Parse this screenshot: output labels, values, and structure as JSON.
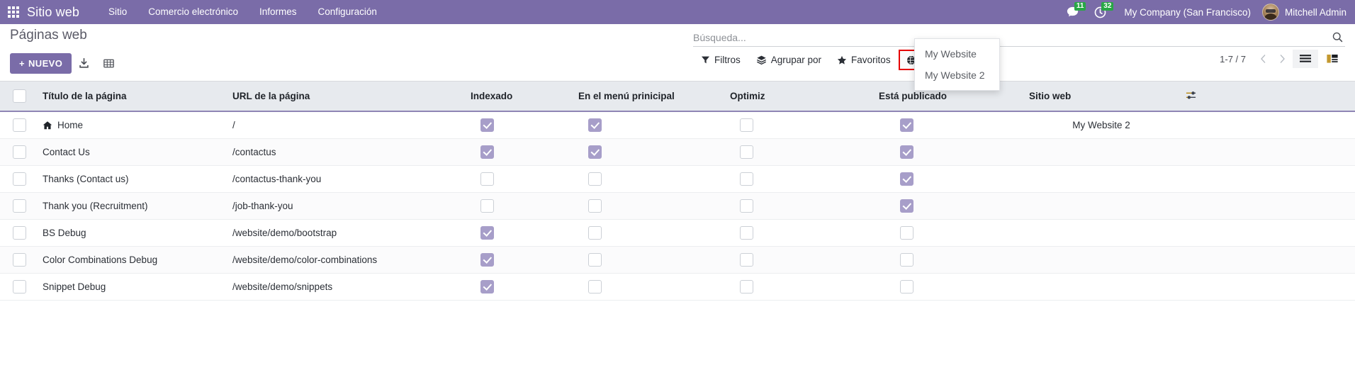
{
  "navbar": {
    "apps_icon": "apps-grid-icon",
    "brand": "Sitio web",
    "menu": [
      {
        "label": "Sitio"
      },
      {
        "label": "Comercio electrónico"
      },
      {
        "label": "Informes"
      },
      {
        "label": "Configuración"
      }
    ],
    "messages_icon": "chat-bubble-icon",
    "messages_count": "11",
    "activities_icon": "clock-icon",
    "activities_count": "32",
    "company": "My Company (San Francisco)",
    "user": "Mitchell Admin",
    "avatar_icon": "user-avatar",
    "brand_color": "#7a6ca8",
    "badge_color": "#28a745"
  },
  "control_panel": {
    "title": "Páginas web",
    "new_button": "NUEVO",
    "new_button_plus": "+",
    "import_icon": "import-download-icon",
    "spreadsheet_icon": "spreadsheet-grid-icon",
    "search": {
      "placeholder": "Búsqueda...",
      "value": "",
      "icon": "search-icon"
    },
    "filters": [
      {
        "label": "Filtros",
        "icon": "filter-funnel-icon",
        "highlighted": false
      },
      {
        "label": "Agrupar por",
        "icon": "layers-icon",
        "highlighted": false
      },
      {
        "label": "Favoritos",
        "icon": "star-icon",
        "highlighted": false
      },
      {
        "label": "My Website 2",
        "icon": "globe-icon",
        "highlighted": true
      }
    ],
    "highlight_color": "#e60000",
    "pager": {
      "range": "1-7 / 7",
      "prev_icon": "chevron-left-icon",
      "next_icon": "chevron-right-icon"
    },
    "views": [
      {
        "icon": "list-view-icon",
        "active": true
      },
      {
        "icon": "kanban-view-icon",
        "active": false
      }
    ]
  },
  "website_dropdown": {
    "open": true,
    "options": [
      {
        "label": "My Website"
      },
      {
        "label": "My Website 2"
      }
    ]
  },
  "table": {
    "select_all_icon": "select-all-checkbox",
    "config_icon": "column-settings-icon",
    "columns": [
      {
        "key": "select",
        "label": ""
      },
      {
        "key": "title",
        "label": "Título de la página"
      },
      {
        "key": "url",
        "label": "URL de la página"
      },
      {
        "key": "indexed",
        "label": "Indexado"
      },
      {
        "key": "menu",
        "label": "En el menú prinicipal"
      },
      {
        "key": "optim",
        "label": "Optimiz"
      },
      {
        "key": "pub",
        "label": "Está publicado"
      },
      {
        "key": "site",
        "label": "Sitio web"
      },
      {
        "key": "cfg",
        "label": ""
      }
    ],
    "rows": [
      {
        "title": "Home",
        "home_icon": "home-icon",
        "url": "/",
        "indexed": true,
        "menu": true,
        "optim": false,
        "pub": true,
        "site": "My Website 2"
      },
      {
        "title": "Contact Us",
        "home_icon": "",
        "url": "/contactus",
        "indexed": true,
        "menu": true,
        "optim": false,
        "pub": true,
        "site": ""
      },
      {
        "title": "Thanks (Contact us)",
        "home_icon": "",
        "url": "/contactus-thank-you",
        "indexed": false,
        "menu": false,
        "optim": false,
        "pub": true,
        "site": ""
      },
      {
        "title": "Thank you (Recruitment)",
        "home_icon": "",
        "url": "/job-thank-you",
        "indexed": false,
        "menu": false,
        "optim": false,
        "pub": true,
        "site": ""
      },
      {
        "title": "BS Debug",
        "home_icon": "",
        "url": "/website/demo/bootstrap",
        "indexed": true,
        "menu": false,
        "optim": false,
        "pub": false,
        "site": ""
      },
      {
        "title": "Color Combinations Debug",
        "home_icon": "",
        "url": "/website/demo/color-combinations",
        "indexed": true,
        "menu": false,
        "optim": false,
        "pub": false,
        "site": ""
      },
      {
        "title": "Snippet Debug",
        "home_icon": "",
        "url": "/website/demo/snippets",
        "indexed": true,
        "menu": false,
        "optim": false,
        "pub": false,
        "site": ""
      }
    ]
  },
  "colors": {
    "checkbox_checked": "#a79ec9",
    "header_bg": "#e7eaee",
    "header_border": "#8f85b5"
  }
}
